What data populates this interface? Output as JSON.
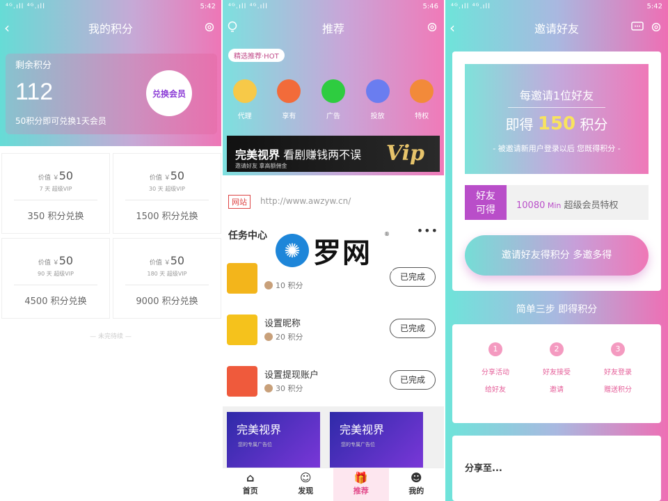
{
  "panel1": {
    "status": {
      "signal": "⁴ᴳ.ıll ⁴ᴳ.ıll",
      "time": "5:42",
      "battery": "83"
    },
    "title": "我的积分",
    "back_icon": "chevron-left-icon",
    "settings_icon": "gear-icon",
    "points_label": "剩余积分",
    "points_value": "112",
    "redeem_button": "兑换会员",
    "points_note": "50积分即可兑换1天会员",
    "price_prefix": "价值 ￥",
    "cards": [
      {
        "price": "50",
        "duration": "7 天 超级VIP",
        "exchange": "350 积分兑换"
      },
      {
        "price": "50",
        "duration": "30 天 超级VIP",
        "exchange": "1500 积分兑换"
      },
      {
        "price": "50",
        "duration": "90 天 超级VIP",
        "exchange": "4500 积分兑换"
      },
      {
        "price": "50",
        "duration": "180 天 超级VIP",
        "exchange": "9000 积分兑换"
      }
    ],
    "no_more": "— 未完待续 —"
  },
  "panel2": {
    "status": {
      "signal": "⁴ᴳ.ıll ⁴ᴳ.ıll",
      "time": "5:46",
      "battery": "83"
    },
    "title": "推荐",
    "hot_tag": "精选推荐·HOT",
    "categories": [
      {
        "label": "代理",
        "color": "#f7c948"
      },
      {
        "label": "享有",
        "color": "#f26b3a"
      },
      {
        "label": "广告",
        "color": "#2ecc40"
      },
      {
        "label": "投放",
        "color": "#6a7df0"
      },
      {
        "label": "特权",
        "color": "#f28a3a"
      }
    ],
    "banner": {
      "title_bold": "完美视界",
      "title_rest": " 看剧赚钱两不误",
      "sub": "邀请好友 拿高额佣金",
      "vip": "Vip"
    },
    "web_badge": "网站",
    "web_url": "http://www.awzyw.cn/",
    "task_title": "任务中心",
    "tasks": [
      {
        "name": "",
        "points": "10 积分",
        "status": "已完成",
        "icon": "avatar-icon",
        "color": "#f3b51b"
      },
      {
        "name": "设置昵称",
        "points": "20 积分",
        "status": "已完成",
        "icon": "pencil-icon",
        "color": "#f5c21c"
      },
      {
        "name": "设置提现账户",
        "points": "30 积分",
        "status": "已完成",
        "icon": "alipay-icon",
        "color": "#ef5a3c"
      }
    ],
    "ads": [
      {
        "title": "完美视界",
        "sub": "您的专属广告位"
      },
      {
        "title": "完美视界",
        "sub": "您的专属广告位"
      }
    ],
    "tabs": [
      {
        "label": "首页",
        "icon": "home-icon",
        "glyph": "⌂"
      },
      {
        "label": "发现",
        "icon": "robot-icon",
        "glyph": "☺"
      },
      {
        "label": "推荐",
        "icon": "gift-icon",
        "glyph": "🎁"
      },
      {
        "label": "我的",
        "icon": "user-icon",
        "glyph": "☻"
      }
    ],
    "logo": {
      "text": "罗网",
      "reg": "®"
    }
  },
  "panel3": {
    "status": {
      "signal": "⁴ᴳ.ıll ⁴ᴳ.ıll",
      "time": "5:42",
      "battery": "83"
    },
    "title": "邀请好友",
    "invite_line1": "每邀请1位好友",
    "invite_prefix": "即得 ",
    "invite_points": "150",
    "invite_suffix": " 积分",
    "invite_note": "- 被邀请新用户登录以后 您既得积分 -",
    "ticket_label_1": "好友",
    "ticket_label_2": "可得",
    "ticket_value": "10080",
    "ticket_unit": " Min",
    "ticket_text": " 超级会员特权",
    "invite_button": "邀请好友得积分 多邀多得",
    "steps_title": "简单三步 即得积分",
    "steps": [
      {
        "num": "1",
        "line1": "分享活动",
        "line2": "给好友"
      },
      {
        "num": "2",
        "line1": "好友接受",
        "line2": "邀请"
      },
      {
        "num": "3",
        "line1": "好友登录",
        "line2": "赠送积分"
      }
    ],
    "share_title": "分享至..."
  }
}
